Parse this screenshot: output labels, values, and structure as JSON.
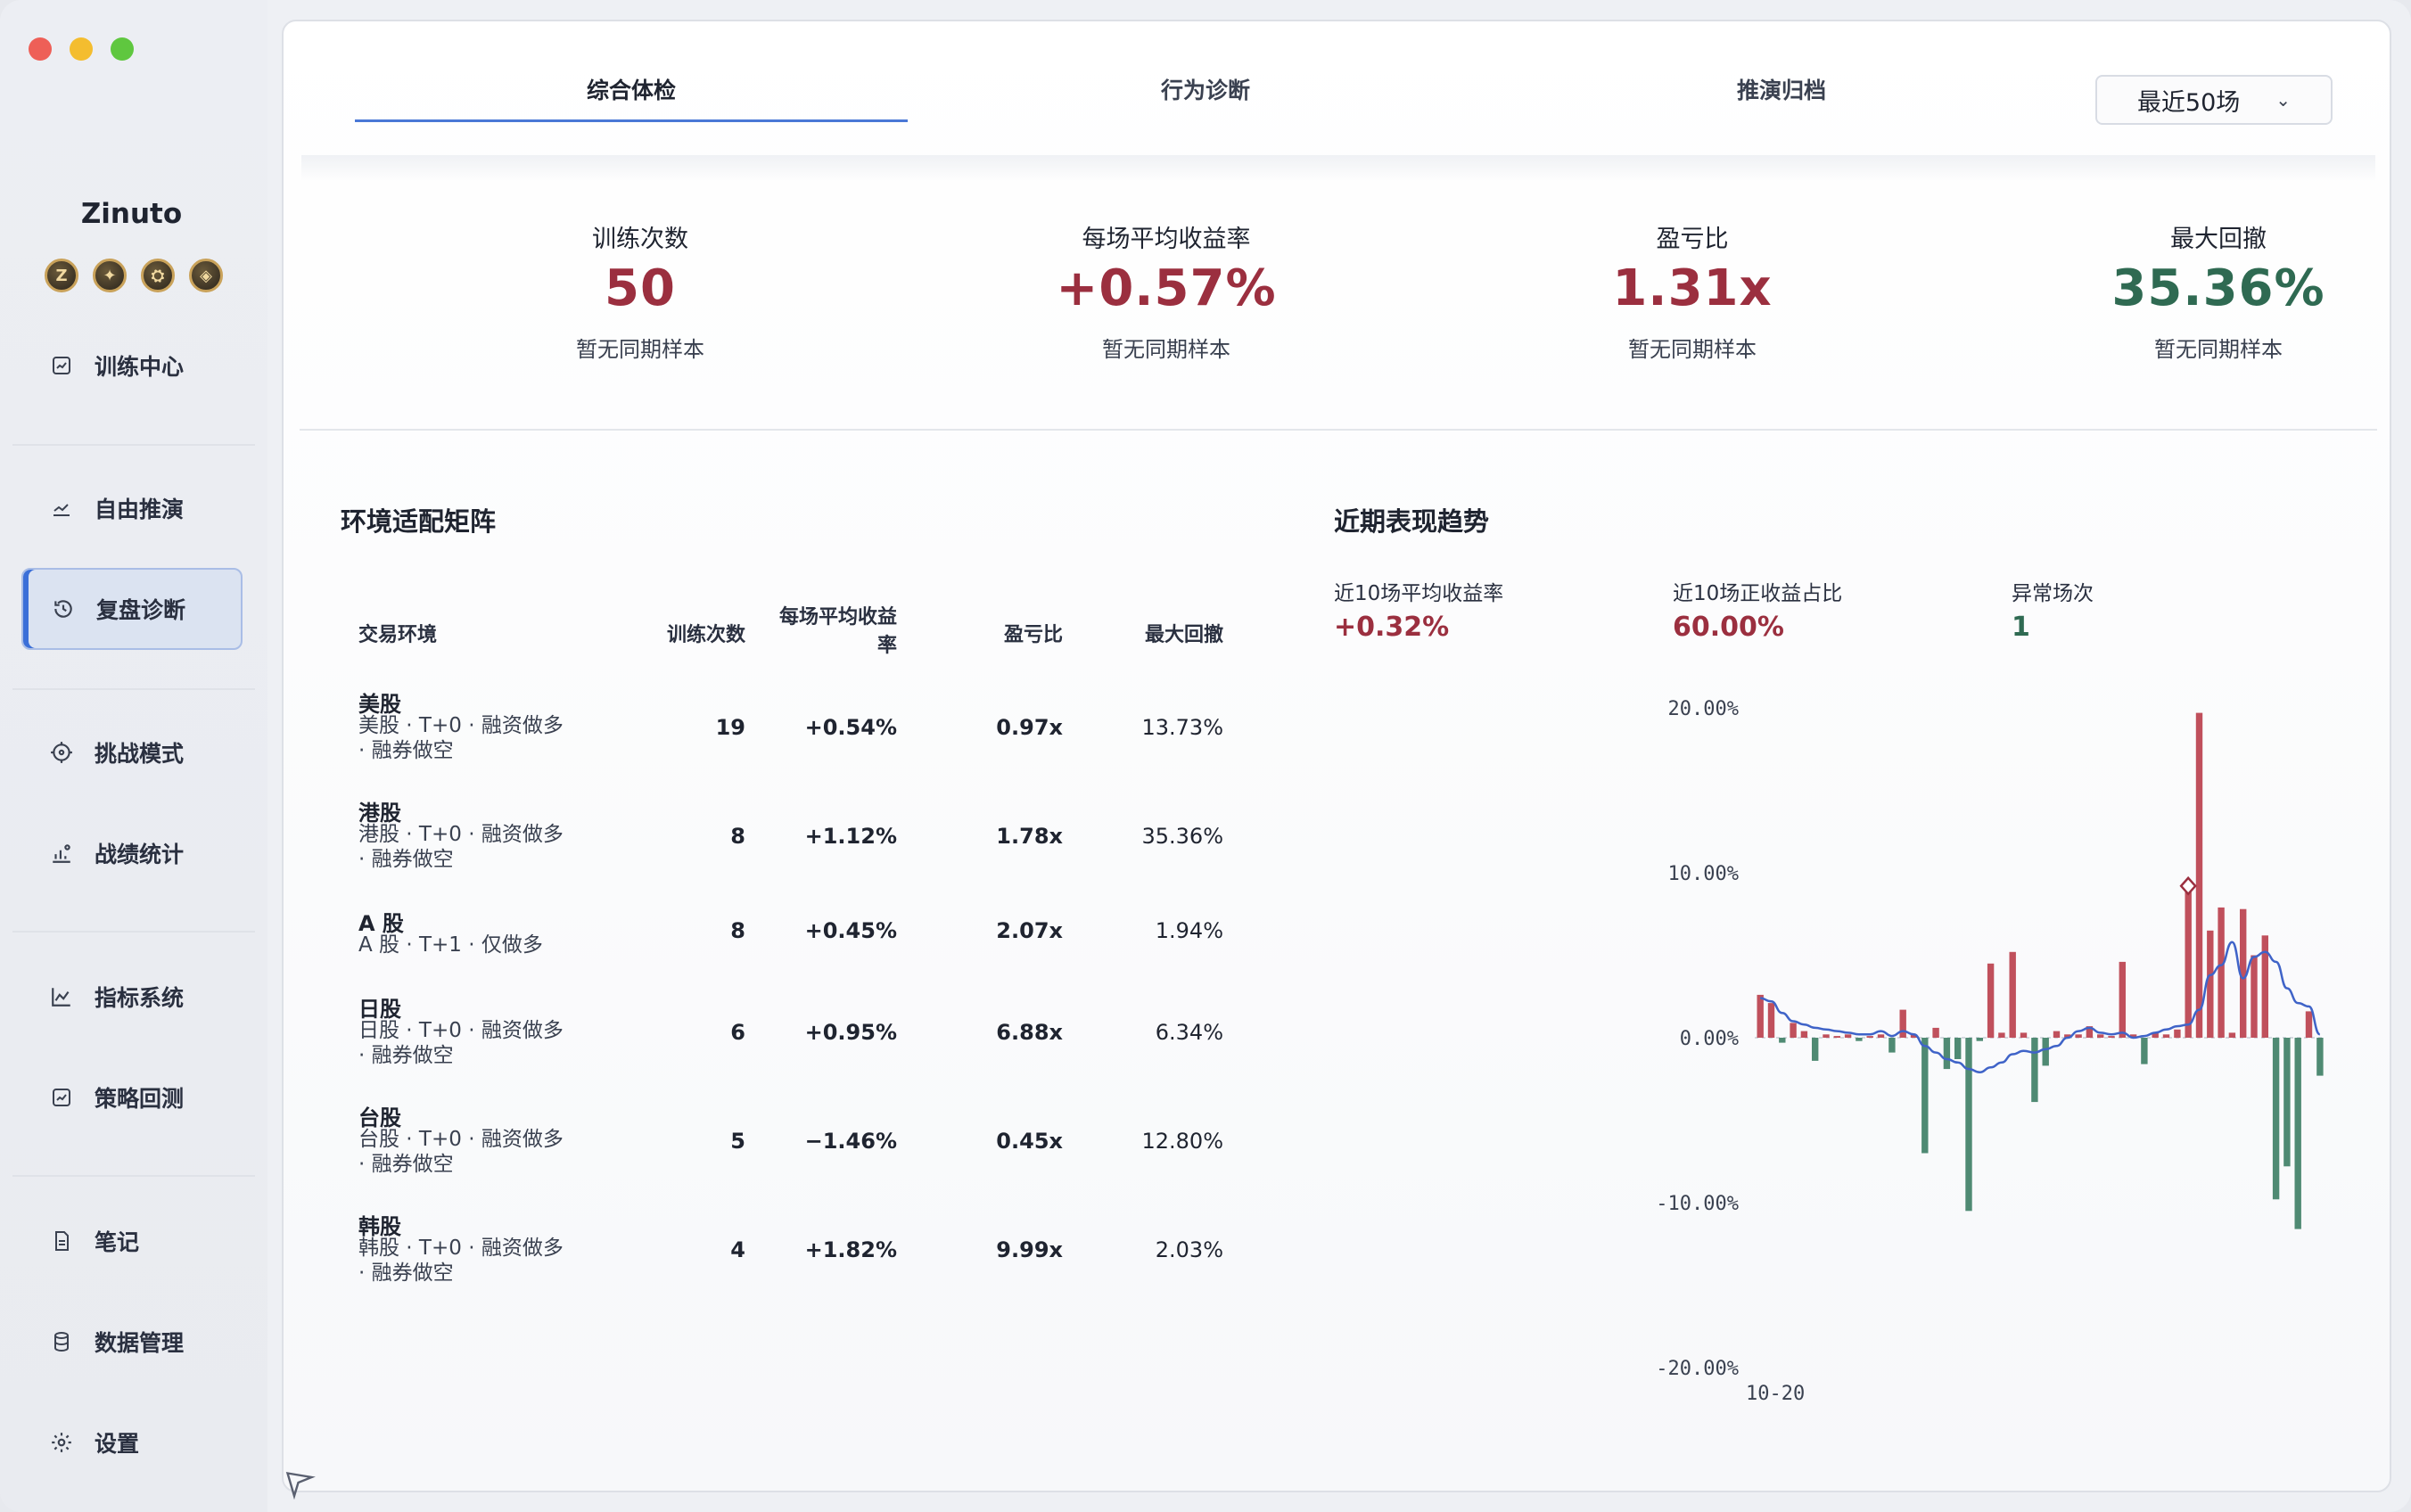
{
  "app": {
    "name": "Zinuto"
  },
  "sidebar": {
    "items": [
      {
        "label": "训练中心",
        "icon": "image-chart-icon"
      },
      {
        "label": "自由推演",
        "icon": "trend-line-icon"
      },
      {
        "label": "复盘诊断",
        "icon": "history-clock-icon",
        "active": true
      },
      {
        "label": "挑战模式",
        "icon": "target-icon"
      },
      {
        "label": "战绩统计",
        "icon": "bar-stats-icon"
      },
      {
        "label": "指标系统",
        "icon": "line-chart-icon"
      },
      {
        "label": "策略回测",
        "icon": "image-chart-icon"
      },
      {
        "label": "笔记",
        "icon": "document-icon"
      },
      {
        "label": "数据管理",
        "icon": "database-icon"
      },
      {
        "label": "设置",
        "icon": "gear-icon"
      }
    ],
    "badges": [
      "Z",
      "✦",
      "⛭",
      "◈"
    ]
  },
  "tabs": [
    {
      "label": "综合体检",
      "active": true
    },
    {
      "label": "行为诊断"
    },
    {
      "label": "推演归档"
    }
  ],
  "range_select": {
    "value": "最近50场"
  },
  "stats": [
    {
      "label": "训练次数",
      "value": "50",
      "sub": "暂无同期样本",
      "tone": "red"
    },
    {
      "label": "每场平均收益率",
      "value": "+0.57%",
      "sub": "暂无同期样本",
      "tone": "red"
    },
    {
      "label": "盈亏比",
      "value": "1.31x",
      "sub": "暂无同期样本",
      "tone": "red"
    },
    {
      "label": "最大回撤",
      "value": "35.36%",
      "sub": "暂无同期样本",
      "tone": "green"
    }
  ],
  "matrix": {
    "title": "环境适配矩阵",
    "headers": {
      "env": "交易环境",
      "count": "训练次数",
      "avg_line1": "每场平均收益",
      "avg_line2": "率",
      "ratio": "盈亏比",
      "drawdown": "最大回撤"
    },
    "rows": [
      {
        "name": "美股",
        "desc": "美股 · T+0 · 融资做多 · 融券做空",
        "count": "19",
        "avg": "+0.54%",
        "ratio": "0.97x",
        "drawdown": "13.73%",
        "avg_tone": "pos",
        "dd_tone": "neutral"
      },
      {
        "name": "港股",
        "desc": "港股 · T+0 · 融资做多 · 融券做空",
        "count": "8",
        "avg": "+1.12%",
        "ratio": "1.78x",
        "drawdown": "35.36%",
        "avg_tone": "pos",
        "dd_tone": "neg"
      },
      {
        "name": "A 股",
        "desc": "A 股 · T+1 · 仅做多",
        "count": "8",
        "avg": "+0.45%",
        "ratio": "2.07x",
        "drawdown": "1.94%",
        "avg_tone": "pos",
        "dd_tone": "neutral"
      },
      {
        "name": "日股",
        "desc": "日股 · T+0 · 融资做多 · 融券做空",
        "count": "6",
        "avg": "+0.95%",
        "ratio": "6.88x",
        "drawdown": "6.34%",
        "avg_tone": "pos",
        "dd_tone": "neutral"
      },
      {
        "name": "台股",
        "desc": "台股 · T+0 · 融资做多 · 融券做空",
        "count": "5",
        "avg": "−1.46%",
        "ratio": "0.45x",
        "drawdown": "12.80%",
        "avg_tone": "neg",
        "dd_tone": "neutral"
      },
      {
        "name": "韩股",
        "desc": "韩股 · T+0 · 融资做多 · 融券做空",
        "count": "4",
        "avg": "+1.82%",
        "ratio": "9.99x",
        "drawdown": "2.03%",
        "avg_tone": "pos",
        "dd_tone": "neutral"
      }
    ]
  },
  "trend": {
    "title": "近期表现趋势",
    "kpis": [
      {
        "label": "近10场平均收益率",
        "value": "+0.32%",
        "tone": "red"
      },
      {
        "label": "近10场正收益占比",
        "value": "60.00%",
        "tone": "red"
      },
      {
        "label": "异常场次",
        "value": "1",
        "tone": "green"
      }
    ]
  },
  "colors": {
    "positive": "#c0505c",
    "negative": "#4f8a73",
    "line": "#3f63c8",
    "accent": "#3b6fd8"
  },
  "chart_data": {
    "type": "bar",
    "title": "",
    "y_tick_labels": [
      "20.00%",
      "10.00%",
      "0.00%",
      "-10.00%",
      "-20.00%"
    ],
    "ylim": [
      -20,
      20
    ],
    "x_tick_labels": [
      "10-20"
    ],
    "grid": false,
    "series": [
      {
        "values": [
          2.6,
          2.1,
          -0.3,
          0.9,
          0.4,
          -1.4,
          0.2,
          0.1,
          0.2,
          -0.2,
          0.1,
          0.2,
          -0.9,
          1.7,
          0.2,
          -7.0,
          0.6,
          -1.9,
          -1.3,
          -10.5,
          -0.2,
          4.5,
          0.3,
          5.2,
          0.3,
          -3.9,
          -1.7,
          0.4,
          0.2,
          0.2,
          0.7,
          0.2,
          0.1,
          4.6,
          0.2,
          -1.6,
          0.3,
          0.2,
          0.5,
          9.2,
          19.7,
          6.5,
          7.9,
          0.3,
          7.8,
          5.0,
          6.2,
          -9.8,
          -7.8,
          -11.6,
          1.6,
          -2.3
        ]
      },
      {
        "values": [
          2.4,
          2.2,
          1.5,
          1.0,
          0.8,
          0.6,
          0.5,
          0.4,
          0.3,
          0.2,
          0.2,
          0.4,
          0.1,
          0.4,
          0.2,
          -0.5,
          -0.9,
          -1.3,
          -1.5,
          -1.9,
          -2.1,
          -1.8,
          -1.5,
          -1.0,
          -0.8,
          -0.9,
          -0.7,
          -0.5,
          0.0,
          0.4,
          0.6,
          0.3,
          0.2,
          0.3,
          0.0,
          0.1,
          0.3,
          0.5,
          0.7,
          0.8,
          1.7,
          3.8,
          4.4,
          5.8,
          3.6,
          4.9,
          5.2,
          4.6,
          3.0,
          2.1,
          1.9,
          0.2
        ]
      }
    ]
  }
}
